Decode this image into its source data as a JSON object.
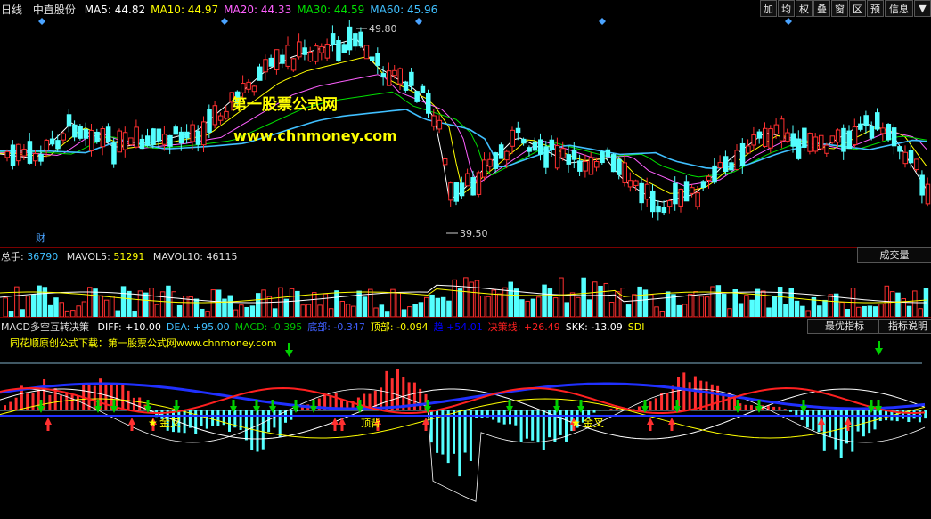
{
  "main": {
    "period": "日线",
    "stock": "中直股份",
    "ma": [
      {
        "label": "MA5:",
        "value": "44.82",
        "color": "#ffffff"
      },
      {
        "label": "MA10:",
        "value": "44.97",
        "color": "#ffff00"
      },
      {
        "label": "MA20:",
        "value": "44.33",
        "color": "#ff60ff"
      },
      {
        "label": "MA30:",
        "value": "44.59",
        "color": "#00e000"
      },
      {
        "label": "MA60:",
        "value": "45.96",
        "color": "#40c0ff"
      }
    ],
    "high_label": "49.80",
    "low_label": "39.50",
    "cai_marker": "财",
    "watermark_title": "第一股票公式网",
    "watermark_url": "www.chnmoney.com"
  },
  "toolbar": [
    "加",
    "均",
    "权",
    "叠",
    "窗",
    "区",
    "预",
    "信息",
    "▼"
  ],
  "volume": {
    "total_label": "总手:",
    "total": "36790",
    "mavol5_label": "MAVOL5:",
    "mavol5": "51291",
    "mavol10_label": "MAVOL10:",
    "mavol10": "46115",
    "dropdown": "成交量"
  },
  "macd": {
    "name": "MACD多空互转决策",
    "items": [
      {
        "label": "DIFF:",
        "value": "+10.00",
        "color": "#ffffff"
      },
      {
        "label": "DEA:",
        "value": "+95.00",
        "color": "#40c0ff"
      },
      {
        "label": "MACD:",
        "value": "-0.395",
        "color": "#00c000"
      },
      {
        "label": "底部:",
        "value": "-0.347",
        "color": "#4060ff"
      },
      {
        "label": "顶部:",
        "value": "-0.094",
        "color": "#ffff00"
      },
      {
        "label": "趋",
        "value": "+54.01",
        "color": "#0000ff"
      },
      {
        "label": "决策线:",
        "value": "+26.49",
        "color": "#ff2020"
      },
      {
        "label": "SKK:",
        "value": "-13.09",
        "color": "#ffffff"
      },
      {
        "label": "SDI",
        "value": "",
        "color": "#ffff00"
      }
    ],
    "best_btn": "最优指标",
    "desc_btn": "指标说明",
    "download_text": "同花顺原创公式下载：第一股票公式网www.chnmoney.com",
    "golden_cross_1": "金叉",
    "golden_cross_2": "金叉",
    "top_label": "顶背"
  },
  "colors": {
    "up": "#ff3030",
    "down": "#54ffff",
    "bg": "#000000",
    "panel_sep": "#7a0000"
  }
}
